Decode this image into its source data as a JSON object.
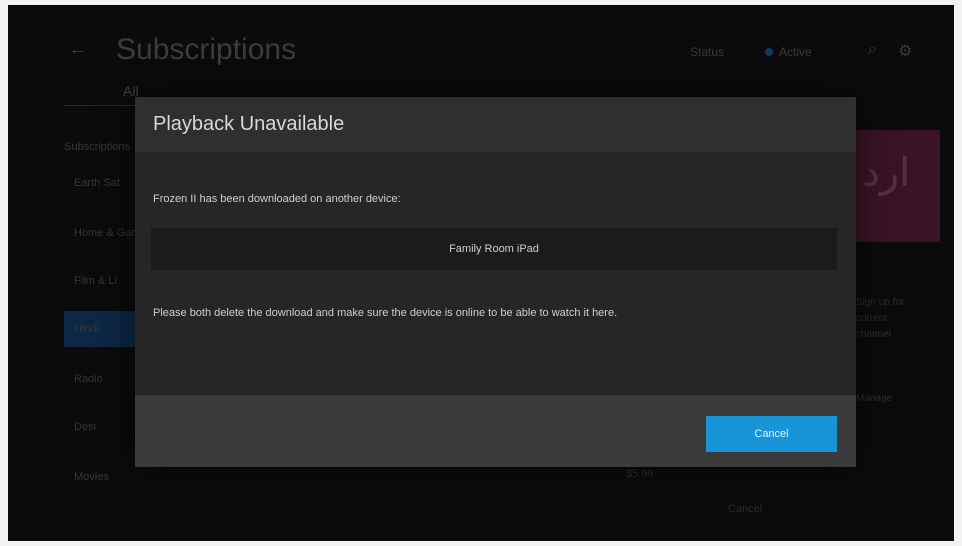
{
  "background": {
    "title": "Subscriptions",
    "status_label": "Status",
    "status_value": "Active",
    "tab": "All",
    "section_label": "Subscriptions",
    "rows": [
      "Earth Sat",
      "Home & Gar",
      "Film & Li",
      "Hindi",
      "Radio",
      "Desi",
      "Movies"
    ],
    "price": "$5.99",
    "art_text": "ارد",
    "side_texts": [
      "Sign up for",
      "current",
      "channel",
      "Manage"
    ],
    "list_row": "Cancel"
  },
  "dialog": {
    "title": "Playback Unavailable",
    "message": "Frozen II has been downloaded on another device:",
    "device_name": "Family Room iPad",
    "instructions": "Please both delete the download and make sure the device is online to be able to watch it here.",
    "cancel_label": "Cancel"
  },
  "colors": {
    "accent": "#1795d6",
    "modal_bg": "#262626",
    "header_bg": "#2f2f2f",
    "footer_bg": "#3b3b3b"
  }
}
